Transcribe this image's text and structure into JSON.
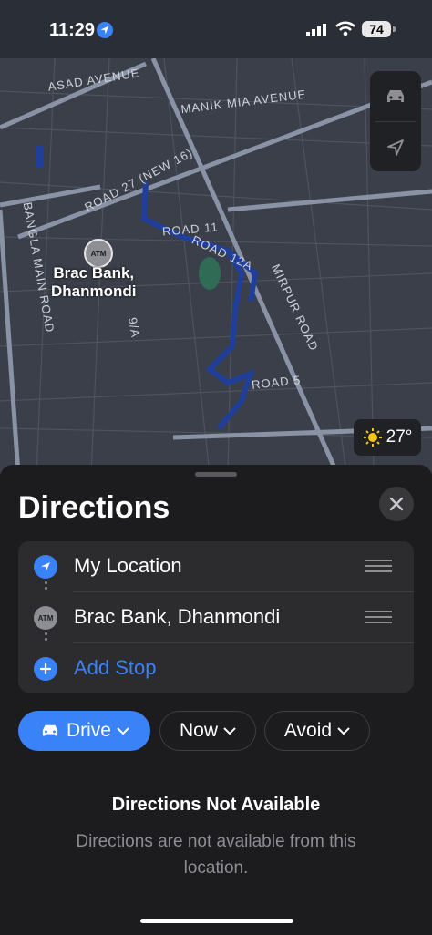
{
  "status": {
    "time": "11:29",
    "battery": "74"
  },
  "map": {
    "labels": {
      "asad": "ASAD AVENUE",
      "manik": "MANIK MIA AVENUE",
      "road27": "ROAD 27 (NEW 16)",
      "road11": "ROAD 11",
      "road12a": "ROAD 12A",
      "mirpur": "MIRPUR ROAD",
      "road5": "ROAD 5",
      "bangla": "BANGLA MAIN ROAD",
      "r9a": "9/A"
    },
    "poi": {
      "badge": "ATM",
      "name_line1": "Brac Bank,",
      "name_line2": "Dhanmondi"
    },
    "weather": "27°"
  },
  "sheet": {
    "title": "Directions",
    "route": {
      "origin": "My Location",
      "destination": "Brac Bank, Dhanmondi",
      "destination_badge": "ATM",
      "add_stop": "Add Stop"
    },
    "options": {
      "drive": "Drive",
      "now": "Now",
      "avoid": "Avoid"
    },
    "not_available_title": "Directions Not Available",
    "not_available_message": "Directions are not available from this location."
  },
  "colors": {
    "accent": "#3a82f7",
    "map_bg": "#3a3f4a",
    "water": "#1a3a8f",
    "park": "#2f6b55"
  }
}
